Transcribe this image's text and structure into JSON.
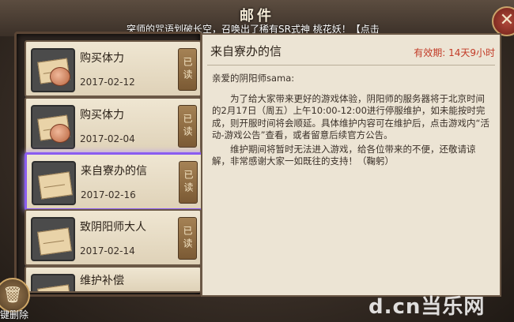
{
  "header": {
    "title": "邮件",
    "marquee": "突师的咒语划破长空，召唤出了稀有SR式神 桃花妖！【点击"
  },
  "mail_list": [
    {
      "title": "购买体力",
      "date": "2017-02-12",
      "status": "已读",
      "icon": "envelope-with-bag"
    },
    {
      "title": "购买体力",
      "date": "2017-02-04",
      "status": "已读",
      "icon": "envelope-with-bag"
    },
    {
      "title": "来自寮办的信",
      "date": "2017-02-16",
      "status": "已读",
      "icon": "envelope",
      "selected": true
    },
    {
      "title": "致阴阳师大人",
      "date": "2017-02-14",
      "status": "已读",
      "icon": "envelope"
    },
    {
      "title": "维护补偿",
      "date": "",
      "status": "",
      "icon": "envelope"
    }
  ],
  "batch_delete_label": "键删除",
  "mail_view": {
    "title": "来自寮办的信",
    "validity": "有效期: 14天9小时",
    "greeting": "亲爱的阴阳师sama:",
    "paragraphs": [
      "为了给大家带来更好的游戏体验，阴阳师的服务器将于北京时间的2月17日（周五）上午10:00-12:00进行停服维护，如未能按时完成，则开服时间将会顺延。具体维护内容可在维护后，点击游戏内“活动-游戏公告”查看，或者留意后续官方公告。",
      "维护期间将暂时无法进入游戏，给各位带来的不便，还敬请谅解，非常感谢大家一如既往的支持！（鞠躬）"
    ]
  },
  "watermark": "d.cn当乐网"
}
